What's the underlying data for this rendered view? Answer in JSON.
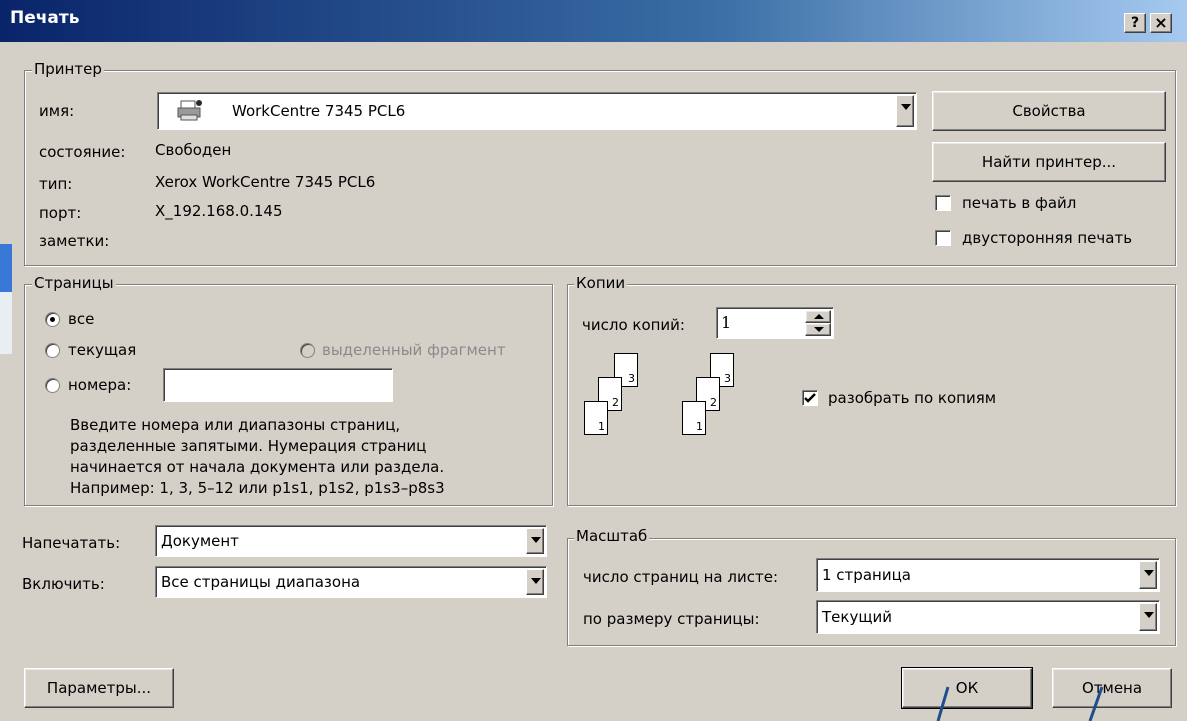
{
  "window": {
    "title": "Печать",
    "help_btn": "?",
    "close_btn": "×"
  },
  "printer": {
    "legend": "Принтер",
    "name_label": "имя:",
    "name_value": "WorkCentre 7345 PCL6",
    "status_label": "состояние:",
    "status_value": "Свободен",
    "type_label": "тип:",
    "type_value": "Xerox WorkCentre 7345 PCL6",
    "port_label": "порт:",
    "port_value": "X_192.168.0.145",
    "notes_label": "заметки:",
    "properties_btn": "Свойства",
    "find_btn": "Найти принтер...",
    "print_to_file": "печать в файл",
    "duplex": "двусторонняя печать"
  },
  "pages": {
    "legend": "Страницы",
    "all": "все",
    "current": "текущая",
    "selection": "выделенный фрагмент",
    "numbers": "номера:",
    "numbers_value": "",
    "hint": [
      "Введите номера или диапазоны страниц,",
      "разделенные запятыми. Нумерация страниц",
      "начинается от начала документа или раздела.",
      "Например: 1, 3, 5–12 или p1s1, p1s2, p1s3–p8s3"
    ]
  },
  "copies": {
    "legend": "Копии",
    "count_label": "число копий:",
    "count_value": "1",
    "collate": "разобрать по копиям",
    "sheet_nums": [
      "1",
      "2",
      "3"
    ]
  },
  "print_what": {
    "label": "Напечатать:",
    "value": "Документ"
  },
  "include": {
    "label": "Включить:",
    "value": "Все страницы диапазона"
  },
  "zoom": {
    "legend": "Масштаб",
    "pages_per_sheet_label": "число страниц на листе:",
    "pages_per_sheet_value": "1 страница",
    "scale_label": "по размеру страницы:",
    "scale_value": "Текущий"
  },
  "footer": {
    "options_btn": "Параметры...",
    "ok_btn": "ОК",
    "cancel_btn": "Отмена"
  }
}
